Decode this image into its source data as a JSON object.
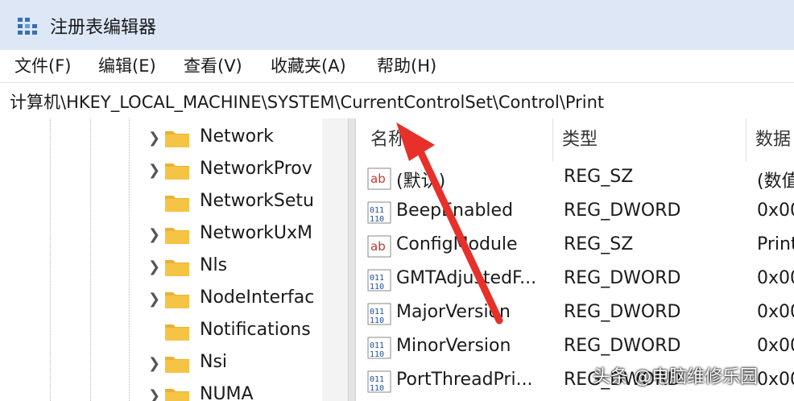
{
  "window": {
    "title": "注册表编辑器"
  },
  "menu": [
    {
      "label": "文件(F)"
    },
    {
      "label": "编辑(E)"
    },
    {
      "label": "查看(V)"
    },
    {
      "label": "收藏夹(A)"
    },
    {
      "label": "帮助(H)"
    }
  ],
  "address": {
    "path": "计算机\\HKEY_LOCAL_MACHINE\\SYSTEM\\CurrentControlSet\\Control\\Print"
  },
  "tree": {
    "items": [
      {
        "label": "Network",
        "expandable": true
      },
      {
        "label": "NetworkProv",
        "expandable": true
      },
      {
        "label": "NetworkSetu",
        "expandable": false
      },
      {
        "label": "NetworkUxM",
        "expandable": true
      },
      {
        "label": "Nls",
        "expandable": true
      },
      {
        "label": "NodeInterfac",
        "expandable": true
      },
      {
        "label": "Notifications",
        "expandable": false
      },
      {
        "label": "Nsi",
        "expandable": true
      },
      {
        "label": "NUMA",
        "expandable": true
      }
    ]
  },
  "list": {
    "headers": {
      "name": "名称",
      "type": "类型",
      "data": "数据"
    },
    "rows": [
      {
        "name": "(默认)",
        "type": "REG_SZ",
        "data": "(数值",
        "icon": "string-value-icon"
      },
      {
        "name": "BeepEnabled",
        "type": "REG_DWORD",
        "data": "0x00",
        "icon": "binary-value-icon"
      },
      {
        "name": "ConfigModule",
        "type": "REG_SZ",
        "data": "Print",
        "icon": "string-value-icon"
      },
      {
        "name": "GMTAdjustedF...",
        "type": "REG_DWORD",
        "data": "0x00",
        "icon": "binary-value-icon"
      },
      {
        "name": "MajorVersion",
        "type": "REG_DWORD",
        "data": "0x00",
        "icon": "binary-value-icon"
      },
      {
        "name": "MinorVersion",
        "type": "REG_DWORD",
        "data": "0x00",
        "icon": "binary-value-icon"
      },
      {
        "name": "PortThreadPri...",
        "type": "REG_DWORD",
        "data": "0x00",
        "icon": "binary-value-icon"
      }
    ]
  },
  "watermark": {
    "text": "头条 @电脑维修乐园"
  },
  "colors": {
    "titlebar": "#dde7f6",
    "folder": "#f6c444",
    "arrow": "#e8302b"
  }
}
